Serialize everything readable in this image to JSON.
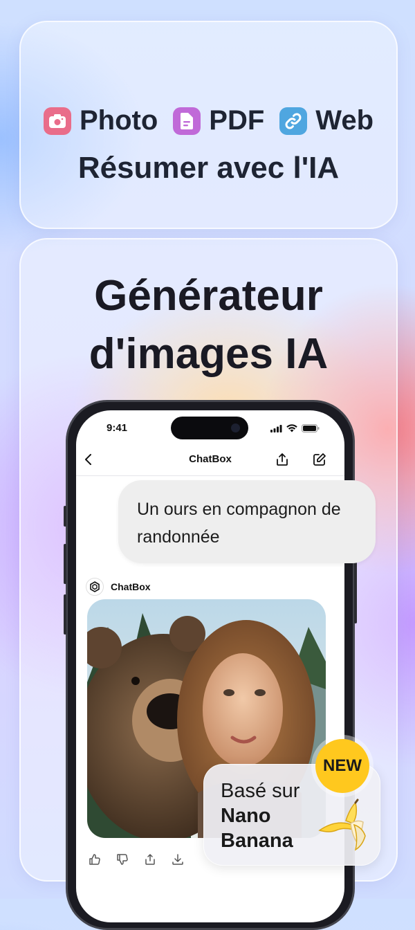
{
  "features": [
    {
      "label": "Photo",
      "icon": "camera-icon",
      "color": "#e96d8a"
    },
    {
      "label": "PDF",
      "icon": "document-icon",
      "color": "#c06ad8"
    },
    {
      "label": "Web",
      "icon": "link-icon",
      "color": "#4fa6e0"
    }
  ],
  "summary_title": "Résumer avec l'IA",
  "headline": {
    "line1": "Générateur",
    "line2": "d'images IA"
  },
  "phone": {
    "time": "9:41",
    "nav_title": "ChatBox",
    "user_message": "Un ours en compagnon de randonnée",
    "bot_name": "ChatBox"
  },
  "badge": {
    "new_label": "NEW",
    "line1": "Basé sur",
    "line2": "Nano",
    "line3": "Banana"
  }
}
